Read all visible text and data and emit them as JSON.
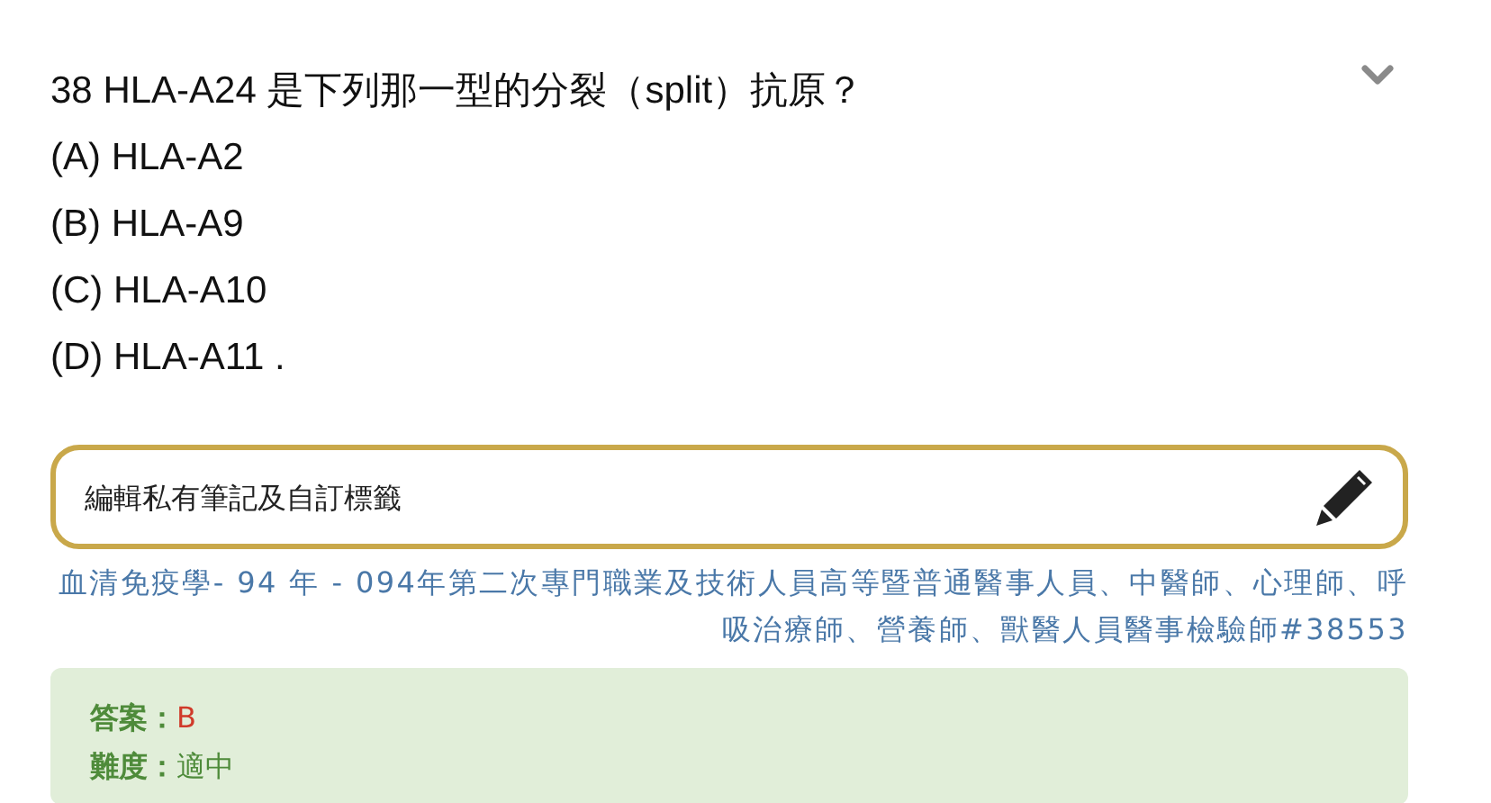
{
  "question": {
    "text": "38 HLA-A24 是下列那一型的分裂（split）抗原？",
    "options": [
      "(A) HLA-A2",
      "(B) HLA-A9",
      "(C) HLA-A10",
      "(D) HLA-A11 ."
    ]
  },
  "note": {
    "placeholder": "編輯私有筆記及自訂標籤"
  },
  "source": "血清免疫學- 94 年 - 094年第二次專門職業及技術人員高等暨普通醫事人員、中醫師、心理師、呼吸治療師、營養師、獸醫人員醫事檢驗師#38553",
  "answer": {
    "label": "答案：",
    "value": "B"
  },
  "difficulty": {
    "label": "難度：",
    "value": "適中"
  }
}
